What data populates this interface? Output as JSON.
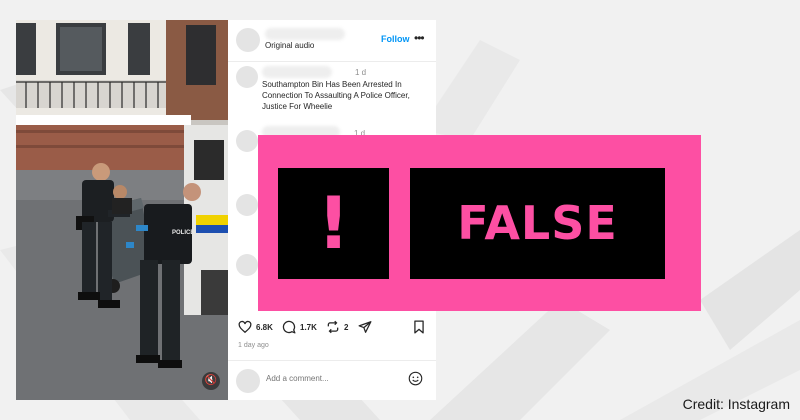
{
  "post": {
    "audio_label": "Original audio",
    "follow_label": "Follow",
    "more_icon": "ellipsis-icon",
    "comments": [
      {
        "time": "1 d",
        "text": "Southampton Bin Has Been Arrested In Connection To Assaulting A Police Officer, Justice For Wheelie"
      },
      {
        "time": "1 d"
      }
    ],
    "actions": {
      "likes": "6.8K",
      "comments": "1.7K",
      "reposts": "2",
      "icons": [
        "heart-icon",
        "comment-icon",
        "repost-icon",
        "share-icon",
        "bookmark-icon"
      ]
    },
    "date": "1 day ago",
    "add_comment_placeholder": "Add a comment...",
    "video_icons": [
      "mute-icon"
    ],
    "video_text": "POLICE"
  },
  "rating": {
    "symbol": "!",
    "label": "FALSE",
    "color": "#fd4fa3"
  },
  "credit": "Credit: Instagram"
}
